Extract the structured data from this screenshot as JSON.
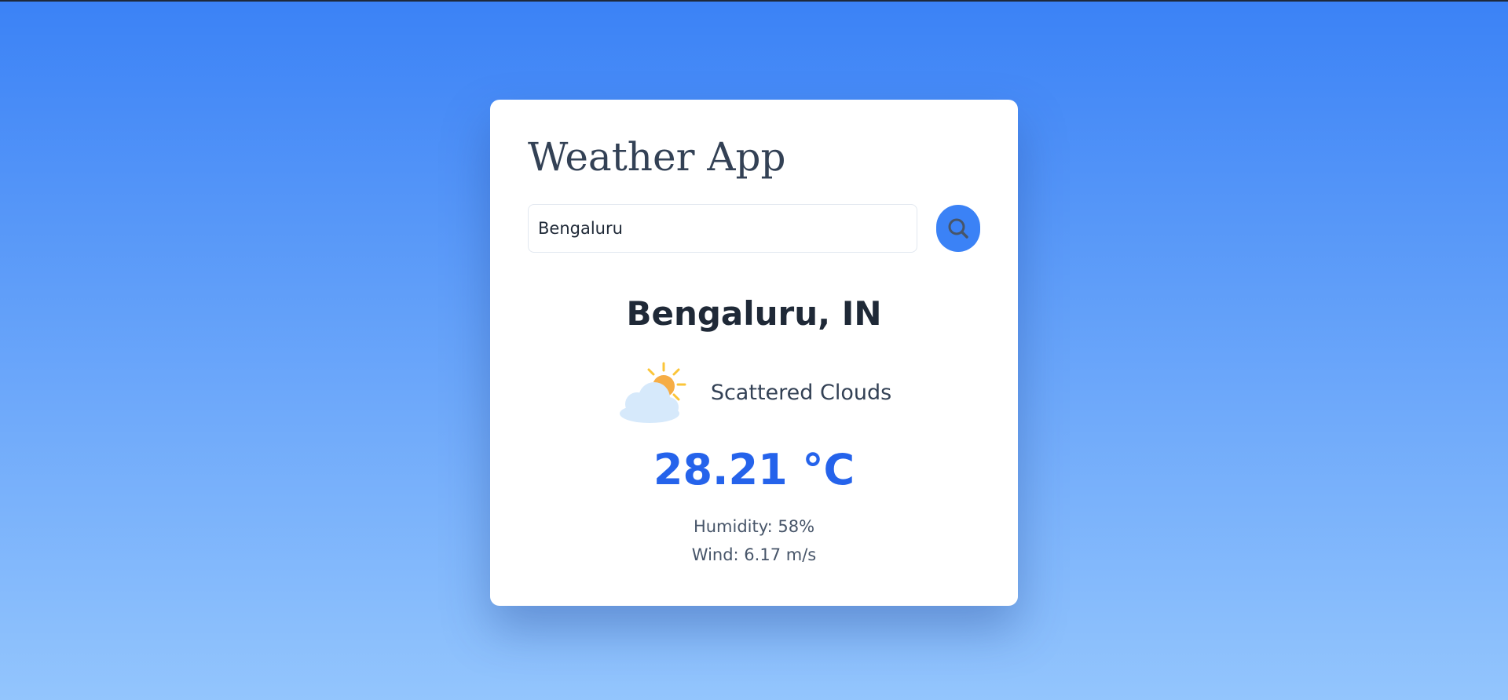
{
  "app": {
    "title": "Weather App"
  },
  "search": {
    "value": "Bengaluru",
    "button_icon": "search-icon"
  },
  "weather": {
    "location": "Bengaluru, IN",
    "icon": "partly-cloudy-sun-icon",
    "description": "Scattered Clouds",
    "temperature": "28.21 °C",
    "humidity_label": "Humidity: 58%",
    "wind_label": "Wind: 6.17 m/s"
  },
  "colors": {
    "background_top": "#3b82f6",
    "background_bottom": "#93c5fd",
    "accent": "#2563eb",
    "button": "#3b82f6",
    "card": "#ffffff"
  }
}
